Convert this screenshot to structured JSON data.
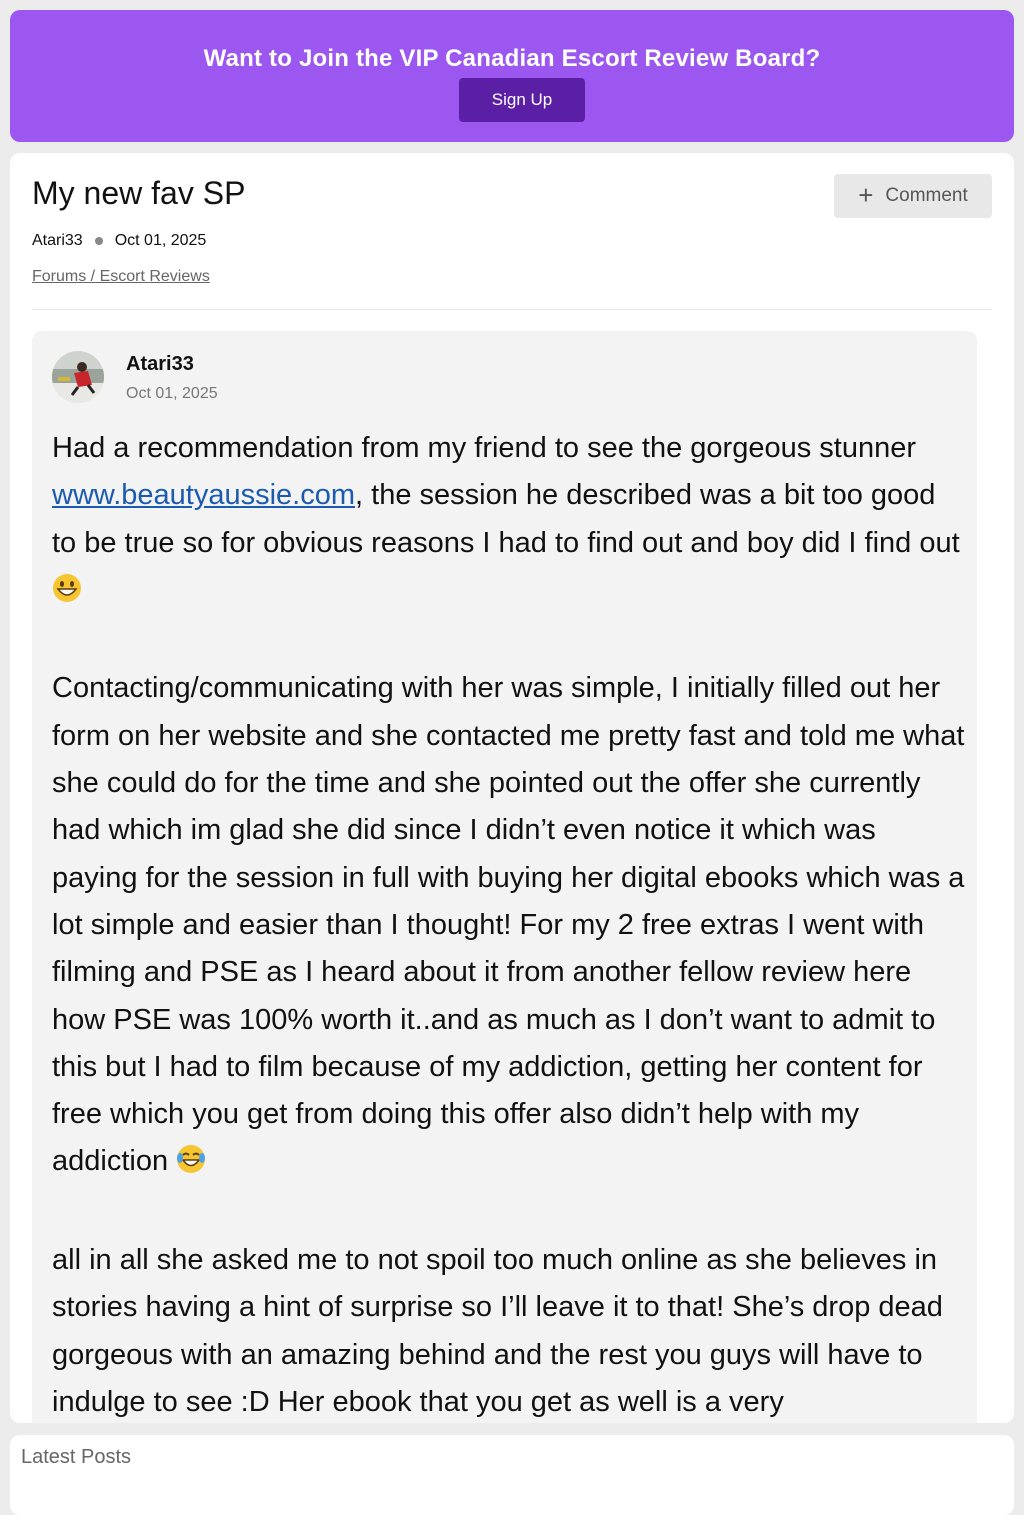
{
  "banner": {
    "title": "Want to Join the VIP Canadian Escort Review Board?",
    "signup_label": "Sign Up",
    "color": "#9b57ef",
    "button_color": "#5b1fa6"
  },
  "thread": {
    "title": "My new fav SP",
    "author": "Atari33",
    "date": "Oct 01, 2025",
    "breadcrumb": "Forums / Escort Reviews",
    "comment_label": "Comment",
    "comment_icon": "plus-icon"
  },
  "post": {
    "author": "Atari33",
    "date": "Oct 01, 2025",
    "avatar_icon": "user-avatar",
    "p1_before_link": "Had a recommendation from my friend to see the gorgeous stunner ",
    "link_text": "www.beautyaussie.com",
    "p1_after_link": ", the session he described was a bit too good to be true so for obvious reasons I had to find out and boy did I find out",
    "p2": "Contacting/communicating with her was simple, I initially filled out her form on her website and she contacted me pretty fast and told me what she could do for the time and she pointed out the offer she currently had which im glad she did since I didn’t even notice it which was paying for the session in full with buying her digital ebooks which was a lot simple and easier than I thought! For my 2 free extras I went with filming and PSE as I heard about it from another fellow review here how PSE was 100% worth it..and as much as I don’t want to admit to this but I had to film because of my addiction, getting her content for free which you get from doing this offer also didn’t help with my addiction",
    "p3": "all in all she asked me to not spoil too much online as she believes in stories having a hint of surprise so I’ll leave it to that! She’s drop dead gorgeous with an amazing behind and the rest you guys will have to indulge to see :D Her ebook that you get as well is a very",
    "link_color": "#1a5bb0"
  },
  "latest": {
    "title": "Latest Posts"
  }
}
